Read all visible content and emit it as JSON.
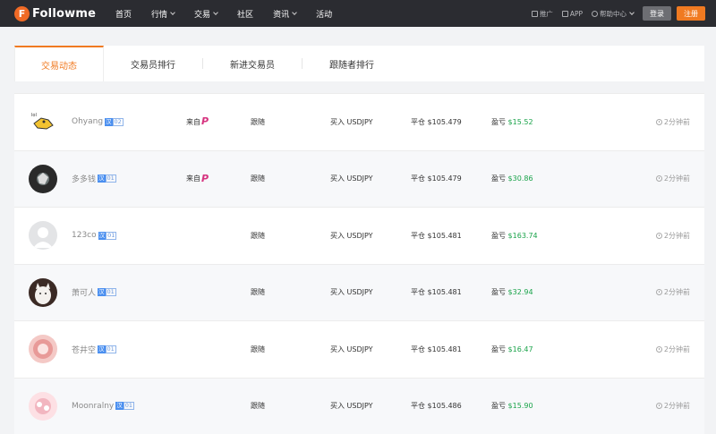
{
  "nav": {
    "logo_text": "Followme",
    "logo_mark": "F",
    "items": [
      {
        "label": "首页",
        "dropdown": false
      },
      {
        "label": "行情",
        "dropdown": true
      },
      {
        "label": "交易",
        "dropdown": true
      },
      {
        "label": "社区",
        "dropdown": false
      },
      {
        "label": "资讯",
        "dropdown": true
      },
      {
        "label": "活动",
        "dropdown": false
      }
    ],
    "utils": [
      {
        "label": "推广",
        "icon": "share-icon"
      },
      {
        "label": "APP",
        "icon": "phone-icon"
      },
      {
        "label": "帮助中心",
        "icon": "help-icon"
      }
    ],
    "login_label": "登录",
    "register_label": "注册"
  },
  "tabs": [
    {
      "label": "交易动态",
      "active": true
    },
    {
      "label": "交易员排行",
      "active": false
    },
    {
      "label": "新进交易员",
      "active": false
    },
    {
      "label": "跟随者排行",
      "active": false
    }
  ],
  "colors": {
    "accent": "#f07a21",
    "nav_bg": "#2b2c31",
    "profit": "#1aa34a"
  },
  "rows": [
    {
      "user": "Ohyang",
      "badge_a": "汉",
      "badge_b": "02",
      "source_label": "来自",
      "source_logo": "P",
      "follow": "跟随",
      "action": "买入 USDJPY",
      "close_label": "平仓",
      "close_value": "$105.479",
      "profit_label": "盈亏",
      "profit_value": "$15.52",
      "time": "2分钟前",
      "avatar": "cartoon"
    },
    {
      "user": "多多钱",
      "badge_a": "汉",
      "badge_b": "01",
      "source_label": "来自",
      "source_logo": "P",
      "follow": "跟随",
      "action": "买入 USDJPY",
      "close_label": "平仓",
      "close_value": "$105.479",
      "profit_label": "盈亏",
      "profit_value": "$30.86",
      "time": "2分钟前",
      "avatar": "dark"
    },
    {
      "user": "123co",
      "badge_a": "汉",
      "badge_b": "01",
      "source_label": "",
      "source_logo": "",
      "follow": "跟随",
      "action": "买入 USDJPY",
      "close_label": "平仓",
      "close_value": "$105.481",
      "profit_label": "盈亏",
      "profit_value": "$163.74",
      "time": "2分钟前",
      "avatar": "default"
    },
    {
      "user": "萧可人",
      "badge_a": "汉",
      "badge_b": "01",
      "source_label": "",
      "source_logo": "",
      "follow": "跟随",
      "action": "买入 USDJPY",
      "close_label": "平仓",
      "close_value": "$105.481",
      "profit_label": "盈亏",
      "profit_value": "$32.94",
      "time": "2分钟前",
      "avatar": "cat"
    },
    {
      "user": "苍井空",
      "badge_a": "汉",
      "badge_b": "01",
      "source_label": "",
      "source_logo": "",
      "follow": "跟随",
      "action": "买入 USDJPY",
      "close_label": "平仓",
      "close_value": "$105.481",
      "profit_label": "盈亏",
      "profit_value": "$16.47",
      "time": "2分钟前",
      "avatar": "pink"
    },
    {
      "user": "Moonralny",
      "badge_a": "汉",
      "badge_b": "01",
      "source_label": "",
      "source_logo": "",
      "follow": "跟随",
      "action": "买入 USDJPY",
      "close_label": "平仓",
      "close_value": "$105.486",
      "profit_label": "盈亏",
      "profit_value": "$15.90",
      "time": "2分钟前",
      "avatar": "pink2"
    }
  ]
}
